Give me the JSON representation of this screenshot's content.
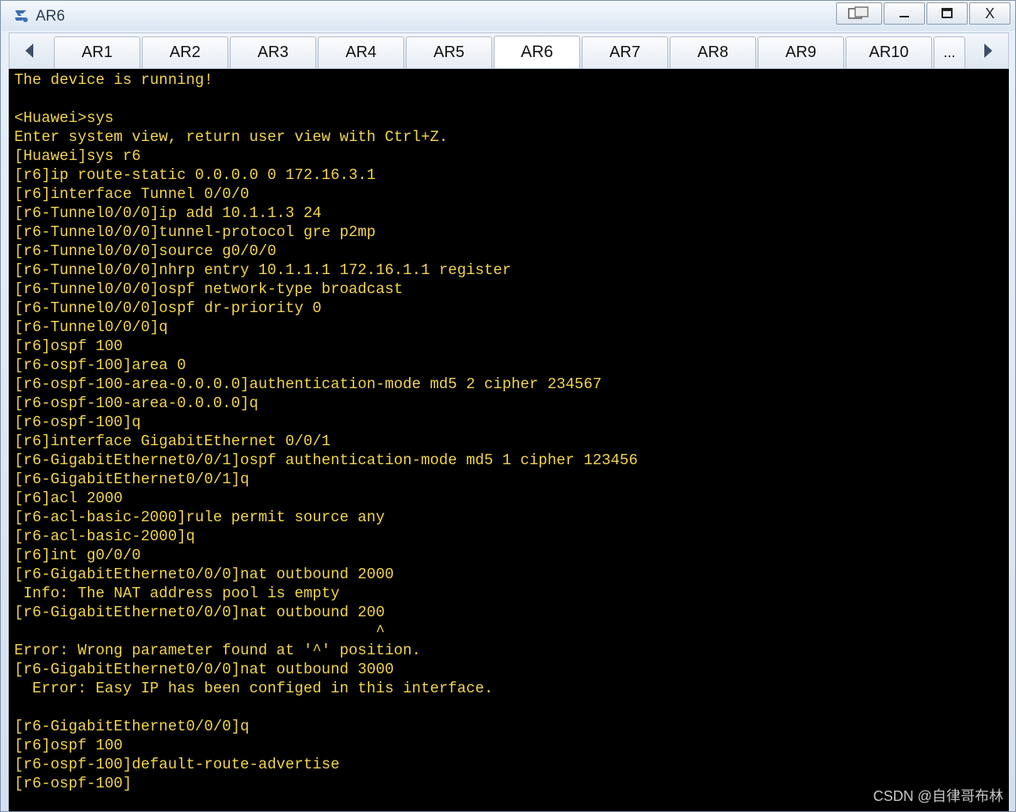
{
  "window": {
    "title": "AR6",
    "controls": {
      "restore_icon": "restore-window-icon",
      "minimize_label": "—",
      "maximize_label": "☐",
      "close_label": "X"
    }
  },
  "tabs": {
    "items": [
      "AR1",
      "AR2",
      "AR3",
      "AR4",
      "AR5",
      "AR6",
      "AR7",
      "AR8",
      "AR9",
      "AR10"
    ],
    "active": "AR6",
    "more_label": "..."
  },
  "terminal": {
    "text_color": "#f1d44a",
    "lines": [
      "The device is running!",
      "",
      "<Huawei>sys",
      "Enter system view, return user view with Ctrl+Z.",
      "[Huawei]sys r6",
      "[r6]ip route-static 0.0.0.0 0 172.16.3.1",
      "[r6]interface Tunnel 0/0/0",
      "[r6-Tunnel0/0/0]ip add 10.1.1.3 24",
      "[r6-Tunnel0/0/0]tunnel-protocol gre p2mp",
      "[r6-Tunnel0/0/0]source g0/0/0",
      "[r6-Tunnel0/0/0]nhrp entry 10.1.1.1 172.16.1.1 register",
      "[r6-Tunnel0/0/0]ospf network-type broadcast",
      "[r6-Tunnel0/0/0]ospf dr-priority 0",
      "[r6-Tunnel0/0/0]q",
      "[r6]ospf 100",
      "[r6-ospf-100]area 0",
      "[r6-ospf-100-area-0.0.0.0]authentication-mode md5 2 cipher 234567",
      "[r6-ospf-100-area-0.0.0.0]q",
      "[r6-ospf-100]q",
      "[r6]interface GigabitEthernet 0/0/1",
      "[r6-GigabitEthernet0/0/1]ospf authentication-mode md5 1 cipher 123456",
      "[r6-GigabitEthernet0/0/1]q",
      "[r6]acl 2000",
      "[r6-acl-basic-2000]rule permit source any",
      "[r6-acl-basic-2000]q",
      "[r6]int g0/0/0",
      "[r6-GigabitEthernet0/0/0]nat outbound 2000",
      " Info: The NAT address pool is empty",
      "[r6-GigabitEthernet0/0/0]nat outbound 200",
      "                                        ^",
      "Error: Wrong parameter found at '^' position.",
      "[r6-GigabitEthernet0/0/0]nat outbound 3000",
      "  Error: Easy IP has been configed in this interface.",
      "",
      "[r6-GigabitEthernet0/0/0]q",
      "[r6]ospf 100",
      "[r6-ospf-100]default-route-advertise",
      "[r6-ospf-100]"
    ]
  },
  "watermark": "CSDN @自律哥布林"
}
